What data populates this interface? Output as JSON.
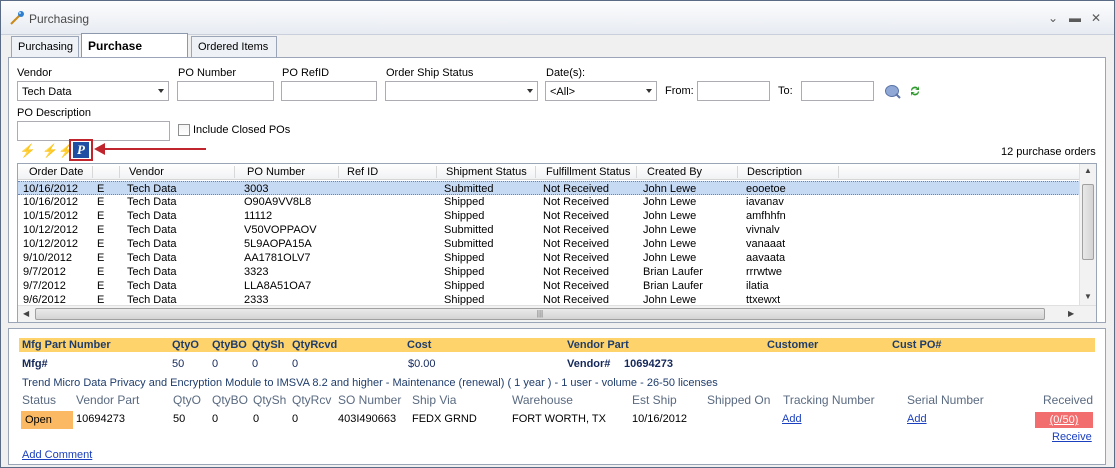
{
  "window": {
    "title": "Purchasing",
    "controls": [
      "⌄",
      "▬",
      "✕"
    ]
  },
  "tabs": [
    {
      "label": "Purchasing",
      "active": false
    },
    {
      "label": "Purchase Orders",
      "active": true
    },
    {
      "label": "Ordered Items",
      "active": false
    }
  ],
  "filters": {
    "vendor": {
      "label": "Vendor",
      "value": "Tech Data"
    },
    "po_number": {
      "label": "PO Number",
      "value": ""
    },
    "po_refid": {
      "label": "PO RefID",
      "value": ""
    },
    "order_ship_status": {
      "label": "Order Ship Status",
      "value": ""
    },
    "dates": {
      "label": "Date(s):",
      "value": "<All>"
    },
    "from": {
      "label": "From:",
      "value": ""
    },
    "to": {
      "label": "To:",
      "value": ""
    },
    "po_description": {
      "label": "PO Description",
      "value": ""
    },
    "include_closed": {
      "label": "Include Closed POs",
      "checked": false
    }
  },
  "toolbar": {
    "po_count": "12 purchase orders",
    "highlight_color": "#c0242c"
  },
  "grid": {
    "columns": [
      "Order Date",
      "Vendor",
      "PO Number",
      "Ref ID",
      "Shipment Status",
      "Fulfillment Status",
      "Created By",
      "Description"
    ],
    "rows": [
      {
        "date": "10/16/2012",
        "flag": "E",
        "vendor": "Tech Data",
        "po": "3003",
        "ref": "",
        "ship": "Submitted",
        "fulfill": "Not Received",
        "by": "John Lewe",
        "desc": "eooetoe"
      },
      {
        "date": "10/16/2012",
        "flag": "E",
        "vendor": "Tech Data",
        "po": "O90A9VV8L8",
        "ref": "",
        "ship": "Shipped",
        "fulfill": "Not Received",
        "by": "John Lewe",
        "desc": "iavanav"
      },
      {
        "date": "10/15/2012",
        "flag": "E",
        "vendor": "Tech Data",
        "po": "11112",
        "ref": "",
        "ship": "Shipped",
        "fulfill": "Not Received",
        "by": "John Lewe",
        "desc": "amfhhfn"
      },
      {
        "date": "10/12/2012",
        "flag": "E",
        "vendor": "Tech Data",
        "po": "V50VOPPAOV",
        "ref": "",
        "ship": "Submitted",
        "fulfill": "Not Received",
        "by": "John Lewe",
        "desc": "vivnalv"
      },
      {
        "date": "10/12/2012",
        "flag": "E",
        "vendor": "Tech Data",
        "po": "5L9AOPA15A",
        "ref": "",
        "ship": "Submitted",
        "fulfill": "Not Received",
        "by": "John Lewe",
        "desc": "vanaaat"
      },
      {
        "date": "9/10/2012",
        "flag": "E",
        "vendor": "Tech Data",
        "po": "AA1781OLV7",
        "ref": "",
        "ship": "Shipped",
        "fulfill": "Not Received",
        "by": "John Lewe",
        "desc": "aavaata"
      },
      {
        "date": "9/7/2012",
        "flag": "E",
        "vendor": "Tech Data",
        "po": "3323",
        "ref": "",
        "ship": "Shipped",
        "fulfill": "Not Received",
        "by": "Brian Laufer",
        "desc": "rrrwtwe"
      },
      {
        "date": "9/7/2012",
        "flag": "E",
        "vendor": "Tech Data",
        "po": "LLA8A51OA7",
        "ref": "",
        "ship": "Shipped",
        "fulfill": "Not Received",
        "by": "Brian Laufer",
        "desc": "ilatia"
      },
      {
        "date": "9/6/2012",
        "flag": "E",
        "vendor": "Tech Data",
        "po": "2333",
        "ref": "",
        "ship": "Shipped",
        "fulfill": "Not Received",
        "by": "John Lewe",
        "desc": "ttxewxt"
      }
    ]
  },
  "detail": {
    "header": {
      "mfg_part_number": "Mfg Part Number",
      "qtyo": "QtyO",
      "qtybo": "QtyBO",
      "qtysh": "QtySh",
      "qtyrcvd": "QtyRcvd",
      "cost": "Cost",
      "vendor_part": "Vendor Part",
      "customer": "Customer",
      "cust_po": "Cust PO#"
    },
    "item": {
      "mfg": "Mfg#",
      "qtyo": "50",
      "qtybo": "0",
      "qtysh": "0",
      "qtyrcvd": "0",
      "cost": "$0.00",
      "vendor_part_label": "Vendor#",
      "vendor_part_value": "10694273"
    },
    "description": "Trend Micro Data Privacy and Encryption Module to IMSVA 8.2 and higher - Maintenance (renewal) ( 1 year ) - 1 user - volume - 26-50 licenses",
    "ship_header": {
      "status": "Status",
      "vendor_part": "Vendor Part",
      "qtyo": "QtyO",
      "qtybo": "QtyBO",
      "qtysh": "QtySh",
      "qtyrcv": "QtyRcv",
      "so_number": "SO Number",
      "ship_via": "Ship Via",
      "warehouse": "Warehouse",
      "est_ship": "Est Ship",
      "shipped_on": "Shipped On",
      "tracking": "Tracking Number",
      "serial": "Serial Number",
      "received": "Received"
    },
    "ship_row": {
      "status": "Open",
      "vendor_part": "10694273",
      "qtyo": "50",
      "qtybo": "0",
      "qtysh": "0",
      "qtyrcv": "0",
      "so_number": "403I490663",
      "ship_via": "FEDX GRND",
      "warehouse": "FORT WORTH, TX",
      "est_ship": "10/16/2012",
      "tracking_link": "Add",
      "serial_link": "Add",
      "received_value": "(0/50)",
      "receive_link": "Receive"
    },
    "add_comment": "Add Comment"
  }
}
